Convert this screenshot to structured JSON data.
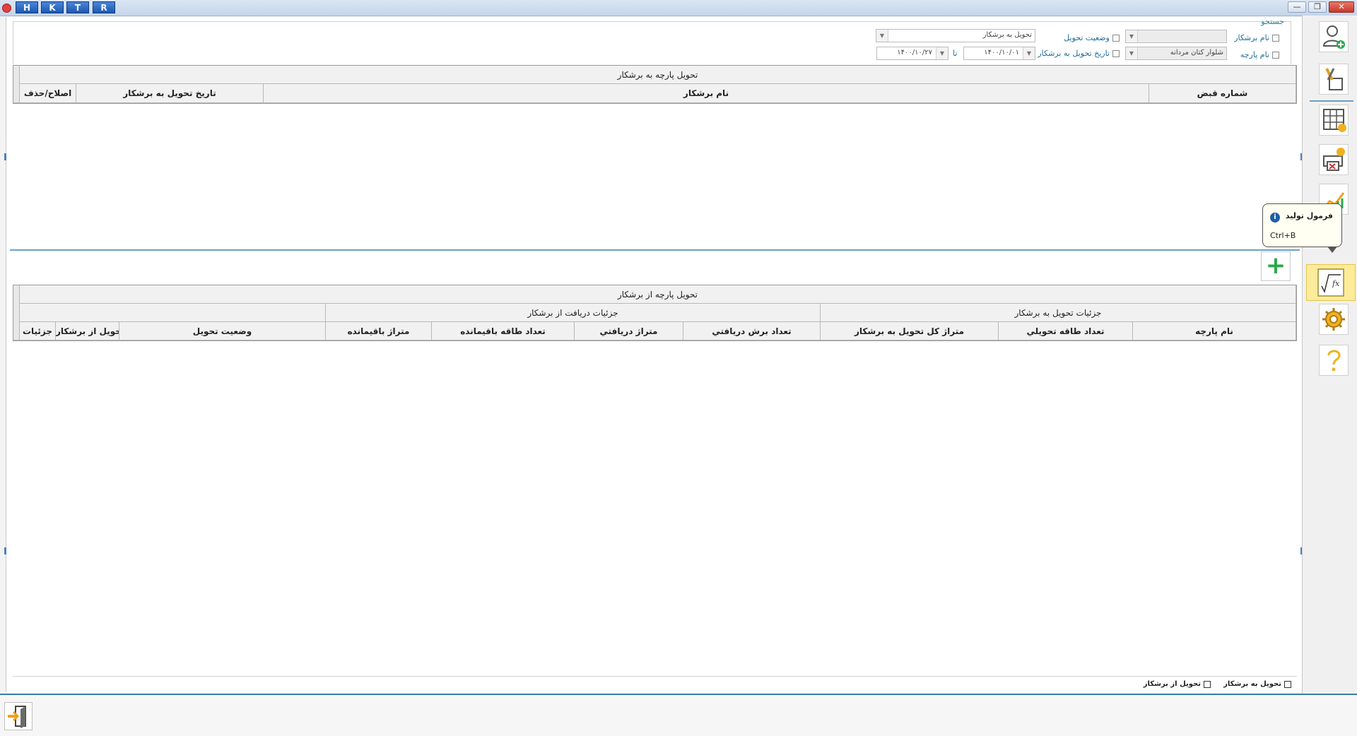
{
  "titlebar": {
    "hotkeys": [
      "H",
      "K",
      "T",
      "R"
    ],
    "minimize": "—",
    "restore": "❐",
    "close": "✕"
  },
  "search": {
    "legend": "جستجو",
    "worker_name_label": "نام برشکار",
    "fabric_name_label": "نام پارچه",
    "fabric_name_value": "شلوار کتان مردانه",
    "delivery_status_label": "وضعيت تحويل",
    "delivery_date_label": "تاریخ تحويل به برشکار",
    "delivery_type_value": "تحويل به برشکار",
    "date_from": "۱۴۰۰/۱۰/۰۱",
    "date_to_label": "تا",
    "date_to": "۱۴۰۰/۱۰/۲۷"
  },
  "grid1": {
    "caption": "تحويل پارچه به برشکار",
    "columns": [
      "شماره قبض",
      "نام برشکار",
      "تاریخ تحويل به برشکار",
      "اصلاح/حذف"
    ]
  },
  "grid2": {
    "caption": "تحويل پارچه از برشکار",
    "group_to": "جزئیات تحويل به برشکار",
    "group_from": "جزئیات دریافت از برشکار",
    "columns": [
      "نام پارچه",
      "تعداد طاقه تحويلي",
      "متراژ کل تحويل به برشکار",
      "تعداد برش دريافتي",
      "متراژ دريافتي",
      "تعداد طاقه باقيمانده",
      "متراژ باقيمانده",
      "وضعيت تحويل",
      "تحويل از برشکار",
      "جزئیات"
    ]
  },
  "add_button": "+",
  "legend": {
    "to_worker": "تحويل به برشکار",
    "from_worker": "تحويل از برشکار"
  },
  "tooltip": {
    "title": "فرمول تولید",
    "shortcut": "Ctrl+B"
  },
  "colors": {
    "accent": "#3a7ea8",
    "active_button": "#fbeb9a",
    "add_green": "#2aa84a"
  }
}
